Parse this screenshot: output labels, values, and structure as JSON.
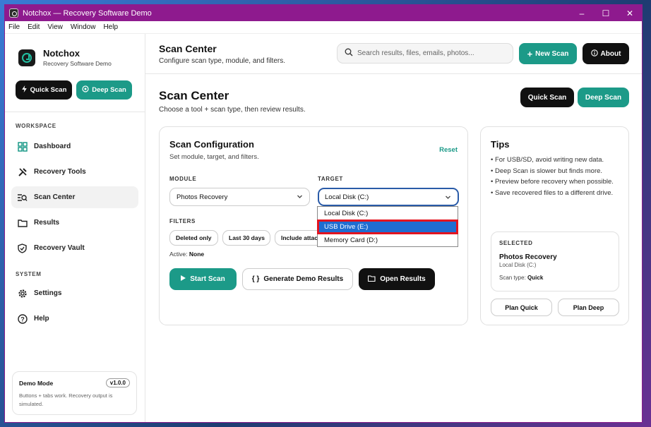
{
  "window": {
    "title": "Notchox — Recovery Software Demo",
    "controls": {
      "minimize": "–",
      "maximize": "☐",
      "close": "✕"
    }
  },
  "menu": [
    "File",
    "Edit",
    "View",
    "Window",
    "Help"
  ],
  "brand": {
    "name": "Notchox",
    "subtitle": "Recovery Software Demo"
  },
  "sidebar": {
    "quick_scan": "Quick Scan",
    "deep_scan": "Deep Scan",
    "workspace_label": "WORKSPACE",
    "system_label": "SYSTEM",
    "workspace_items": [
      {
        "label": "Dashboard",
        "icon": "dashboard-icon"
      },
      {
        "label": "Recovery Tools",
        "icon": "tools-icon"
      },
      {
        "label": "Scan Center",
        "icon": "scan-list-icon",
        "active": true
      },
      {
        "label": "Results",
        "icon": "folder-icon"
      },
      {
        "label": "Recovery Vault",
        "icon": "shield-icon"
      }
    ],
    "system_items": [
      {
        "label": "Settings",
        "icon": "gear-icon"
      },
      {
        "label": "Help",
        "icon": "help-icon"
      }
    ],
    "demo": {
      "title": "Demo Mode",
      "version": "v1.0.0",
      "desc": "Buttons + tabs work. Recovery output is simulated."
    }
  },
  "topbar": {
    "title": "Scan Center",
    "subtitle": "Configure scan type, module, and filters.",
    "search_placeholder": "Search results, files, emails, photos...",
    "new_scan": "New Scan",
    "about": "About"
  },
  "page": {
    "title": "Scan Center",
    "subtitle": "Choose a tool + scan type, then review results.",
    "quick_scan": "Quick Scan",
    "deep_scan": "Deep Scan"
  },
  "config": {
    "title": "Scan Configuration",
    "subtitle": "Set module, target, and filters.",
    "reset": "Reset",
    "module_label": "MODULE",
    "module_value": "Photos Recovery",
    "target_label": "TARGET",
    "target_value": "Local Disk (C:)",
    "target_options": [
      "Local Disk (C:)",
      "USB Drive (E:)",
      "Memory Card (D:)"
    ],
    "target_highlighted": "USB Drive (E:)",
    "filters_label": "FILTERS",
    "filters": [
      "Deleted only",
      "Last 30 days",
      "Include attachments"
    ],
    "active_prefix": "Active:",
    "active_value": "None",
    "start_scan": "Start Scan",
    "generate": "Generate Demo Results",
    "open_results": "Open Results"
  },
  "tips": {
    "title": "Tips",
    "items": [
      "• For USB/SD, avoid writing new data.",
      "• Deep Scan is slower but finds more.",
      "• Preview before recovery when possible.",
      "• Save recovered files to a different drive."
    ],
    "selected_label": "SELECTED",
    "selected_name": "Photos Recovery",
    "selected_target": "Local Disk (C:)",
    "scan_type_prefix": "Scan type:",
    "scan_type_value": "Quick",
    "plan_quick": "Plan Quick",
    "plan_deep": "Plan Deep"
  },
  "colors": {
    "titlebar": "#8e1a8e",
    "accent": "#1c9a88",
    "dark": "#111111",
    "highlight": "#1f6dd1",
    "highlight_border": "#e3141f"
  }
}
